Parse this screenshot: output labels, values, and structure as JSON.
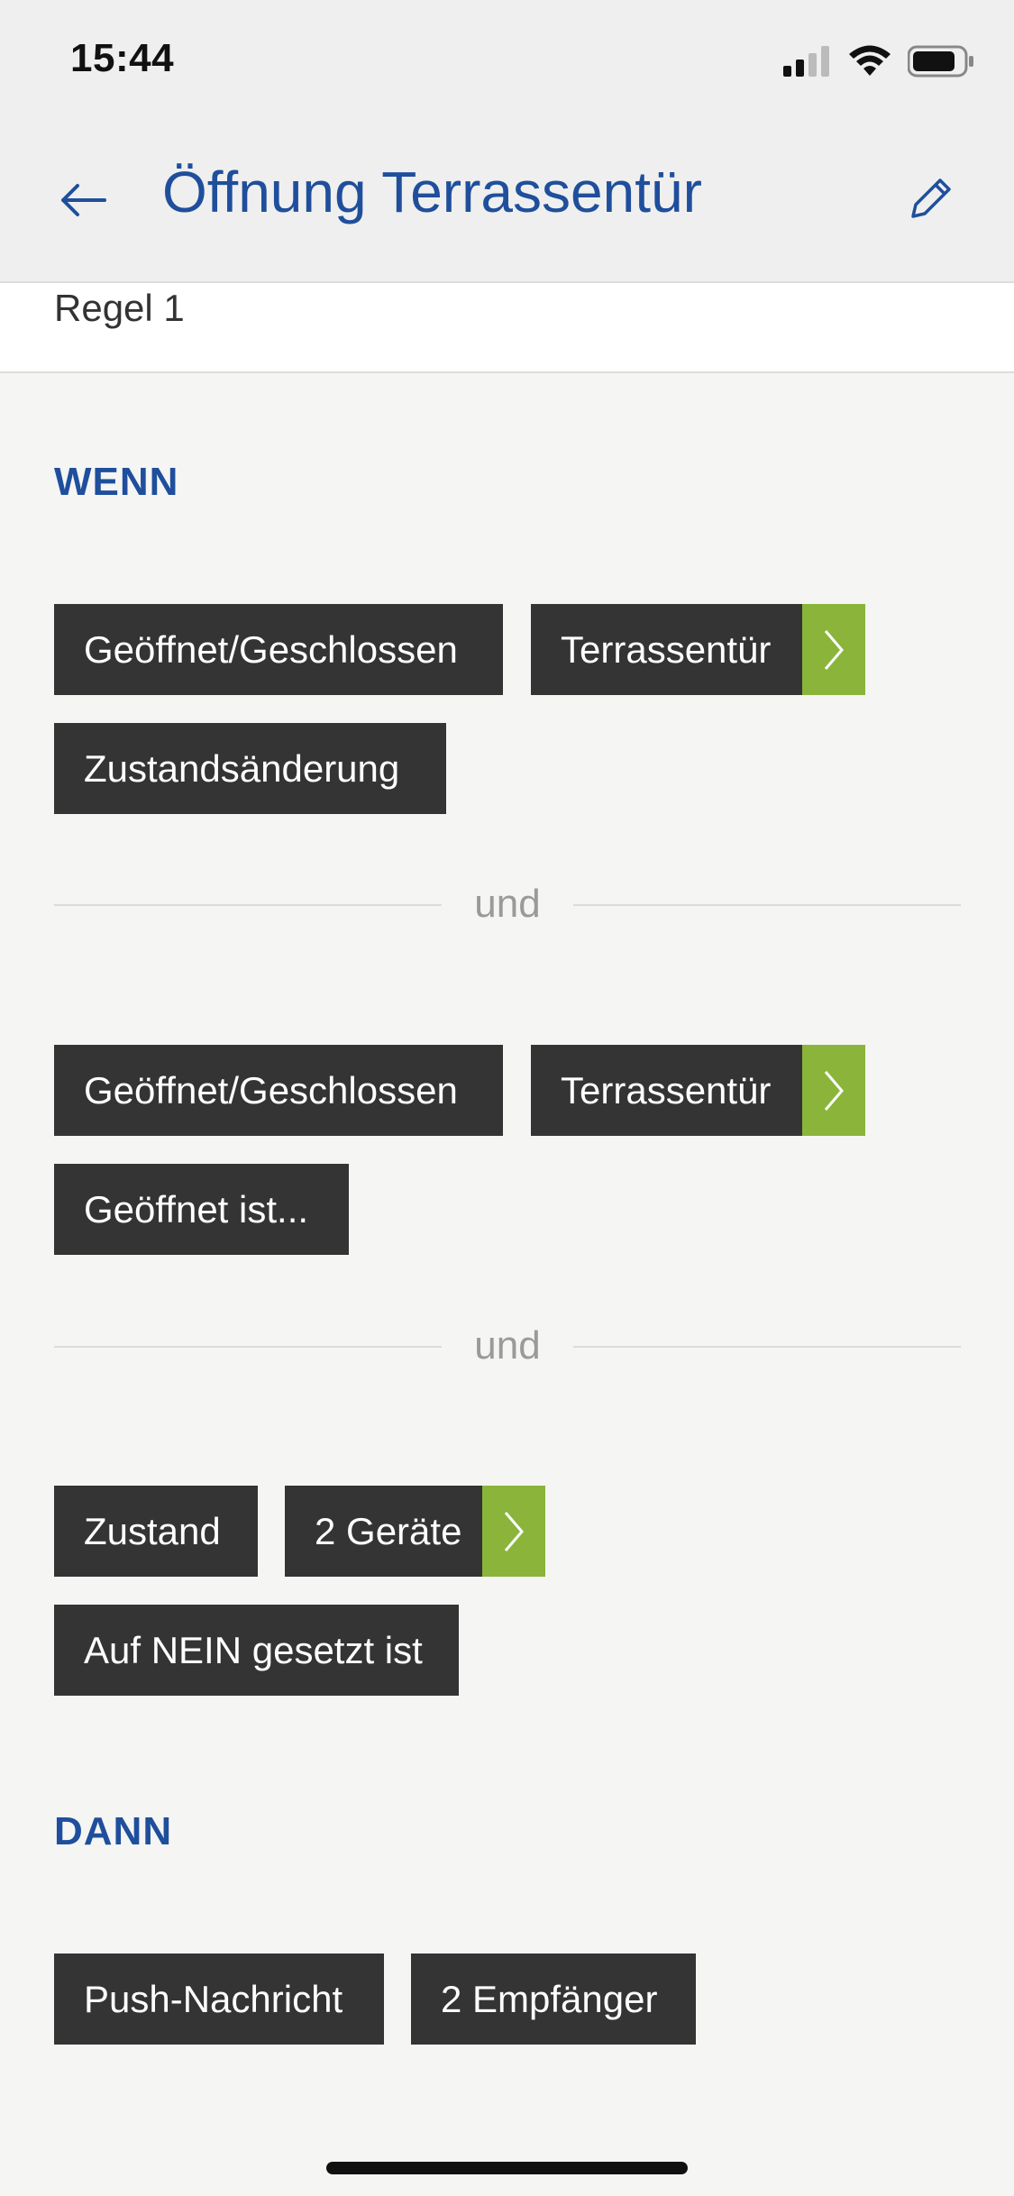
{
  "status": {
    "time": "15:44"
  },
  "header": {
    "title": "Öffnung Terrassentür"
  },
  "rule": {
    "label": "Regel 1"
  },
  "sections": {
    "if_label": "WENN",
    "then_label": "DANN"
  },
  "conditions": [
    {
      "type": "Geöffnet/Geschlossen",
      "device": "Terrassentür",
      "state": "Zustandsänderung"
    },
    {
      "type": "Geöffnet/Geschlossen",
      "device": "Terrassentür",
      "state": "Geöffnet ist..."
    },
    {
      "type": "Zustand",
      "device": "2 Geräte",
      "state": "Auf NEIN gesetzt ist"
    }
  ],
  "connectors": [
    "und",
    "und"
  ],
  "action": {
    "type": "Push-Nachricht",
    "recipients": "2 Empfänger"
  },
  "colors": {
    "accent_blue": "#1f4f9c",
    "chip_bg": "#343434",
    "arrow_green": "#8ab53a"
  },
  "icons": [
    "back-arrow-icon",
    "pencil-icon",
    "chevron-right-icon",
    "signal-icon",
    "wifi-icon",
    "battery-icon"
  ]
}
